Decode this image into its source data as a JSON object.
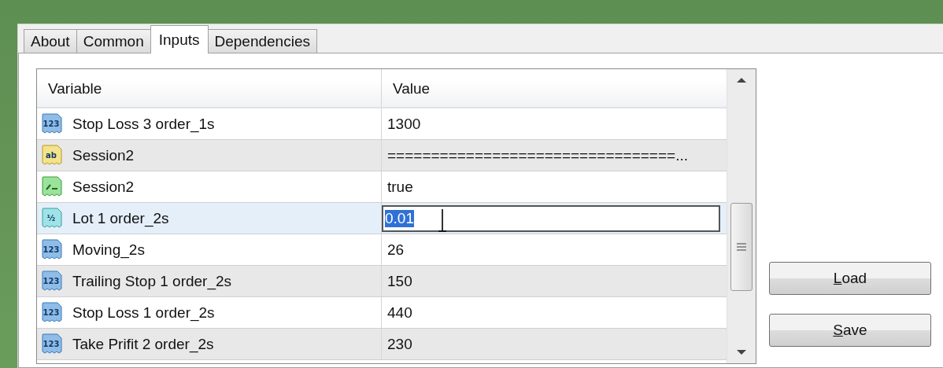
{
  "tabs": [
    {
      "label": "About",
      "selected": false
    },
    {
      "label": "Common",
      "selected": false
    },
    {
      "label": "Inputs",
      "selected": true
    },
    {
      "label": "Dependencies",
      "selected": false
    }
  ],
  "table": {
    "columns": [
      "Variable",
      "Value"
    ],
    "rows": [
      {
        "kind": "int",
        "icon": "123",
        "variable": "Stop Loss 3 order_1s",
        "value": "1300",
        "selected": false,
        "editing": false
      },
      {
        "kind": "string",
        "icon": "ab",
        "variable": "Session2",
        "value": "=================================...",
        "selected": false,
        "editing": false
      },
      {
        "kind": "bool",
        "variable": "Session2",
        "value": "true",
        "selected": false,
        "editing": false
      },
      {
        "kind": "double",
        "icon": "½",
        "variable": "Lot 1 order_2s",
        "value": "0.01",
        "selected": true,
        "editing": true
      },
      {
        "kind": "int",
        "icon": "123",
        "variable": "Moving_2s",
        "value": "26",
        "selected": false,
        "editing": false
      },
      {
        "kind": "int",
        "icon": "123",
        "variable": "Trailing Stop 1 order_2s",
        "value": "150",
        "selected": false,
        "editing": false
      },
      {
        "kind": "int",
        "icon": "123",
        "variable": "Stop Loss 1 order_2s",
        "value": "440",
        "selected": false,
        "editing": false
      },
      {
        "kind": "int",
        "icon": "123",
        "variable": "Take Prifit 2 order_2s",
        "value": "230",
        "selected": false,
        "editing": false
      }
    ]
  },
  "buttons": [
    {
      "accel": "L",
      "text": "oad"
    },
    {
      "accel": "S",
      "text": "ave"
    }
  ]
}
